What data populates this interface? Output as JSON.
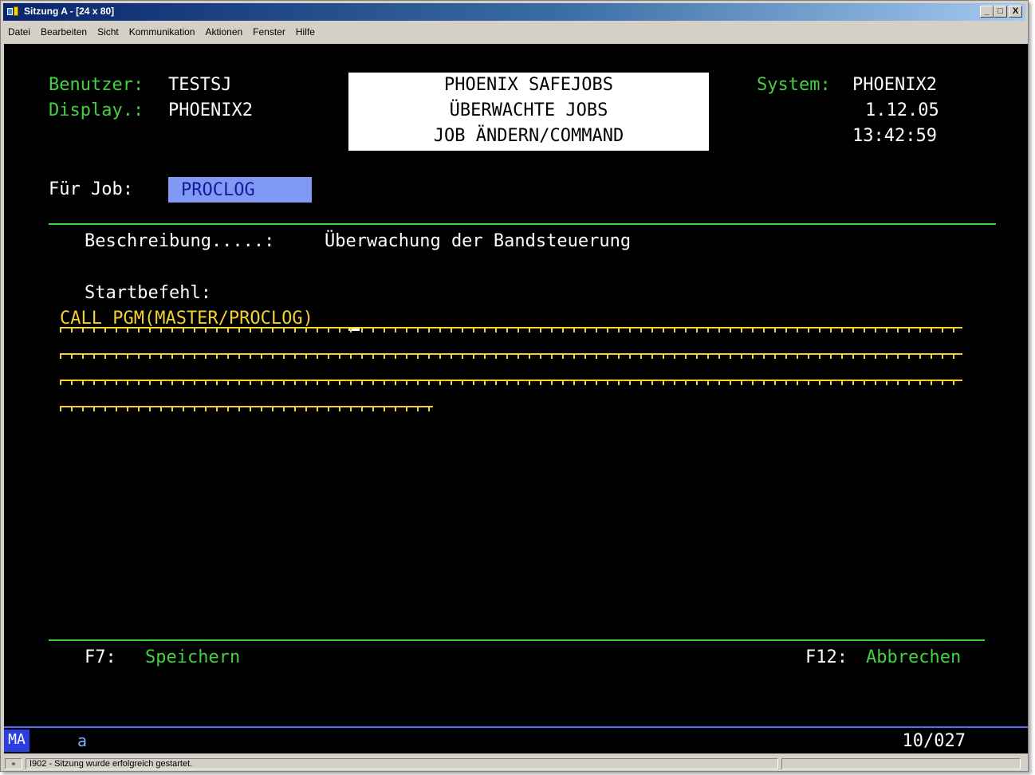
{
  "window": {
    "title": "Sitzung A - [24 x 80]",
    "buttons": {
      "minimize": "_",
      "maximize": "□",
      "close": "X"
    }
  },
  "menu": [
    "Datei",
    "Bearbeiten",
    "Sicht",
    "Kommunikation",
    "Aktionen",
    "Fenster",
    "Hilfe"
  ],
  "screen": {
    "user_label": "Benutzer:",
    "user_value": "TESTSJ",
    "display_label": "Display.:",
    "display_value": "PHOENIX2",
    "header_lines": [
      "PHOENIX SAFEJOBS",
      "ÜBERWACHTE JOBS",
      "JOB ÄNDERN/COMMAND"
    ],
    "system_label": "System:",
    "system_value": "PHOENIX2",
    "date": "1.12.05",
    "time": "13:42:59",
    "job_label": "Für Job:",
    "job_value": "PROCLOG",
    "description_label": "Beschreibung.....:",
    "description_value": "Überwachung der Bandsteuerung",
    "start_label": "Startbefehl:",
    "start_command": "CALL PGM(MASTER/PROCLOG)",
    "f7_key": "F7:",
    "f7_label": "Speichern",
    "f12_key": "F12:",
    "f12_label": "Abbrechen"
  },
  "terminal_status": {
    "mode": "MA",
    "indicator": "a",
    "cursor_position": "10/027"
  },
  "status_bar": {
    "message": "I902 - Sitzung wurde erfolgreich gestartet."
  },
  "colors": {
    "field_label": "#41d141",
    "input": "#f2d130",
    "job_field_bg": "#7f99f5",
    "title_bar": "#0a246a"
  }
}
